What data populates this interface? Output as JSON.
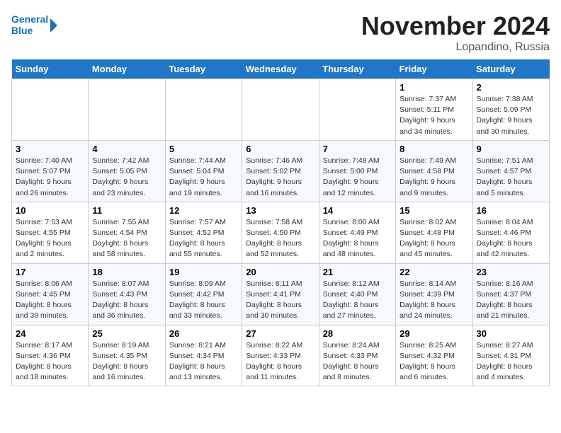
{
  "header": {
    "logo_line1": "General",
    "logo_line2": "Blue",
    "month_title": "November 2024",
    "location": "Lopandino, Russia"
  },
  "weekdays": [
    "Sunday",
    "Monday",
    "Tuesday",
    "Wednesday",
    "Thursday",
    "Friday",
    "Saturday"
  ],
  "weeks": [
    [
      {
        "day": "",
        "info": ""
      },
      {
        "day": "",
        "info": ""
      },
      {
        "day": "",
        "info": ""
      },
      {
        "day": "",
        "info": ""
      },
      {
        "day": "",
        "info": ""
      },
      {
        "day": "1",
        "info": "Sunrise: 7:37 AM\nSunset: 5:11 PM\nDaylight: 9 hours and 34 minutes."
      },
      {
        "day": "2",
        "info": "Sunrise: 7:38 AM\nSunset: 5:09 PM\nDaylight: 9 hours and 30 minutes."
      }
    ],
    [
      {
        "day": "3",
        "info": "Sunrise: 7:40 AM\nSunset: 5:07 PM\nDaylight: 9 hours and 26 minutes."
      },
      {
        "day": "4",
        "info": "Sunrise: 7:42 AM\nSunset: 5:05 PM\nDaylight: 9 hours and 23 minutes."
      },
      {
        "day": "5",
        "info": "Sunrise: 7:44 AM\nSunset: 5:04 PM\nDaylight: 9 hours and 19 minutes."
      },
      {
        "day": "6",
        "info": "Sunrise: 7:46 AM\nSunset: 5:02 PM\nDaylight: 9 hours and 16 minutes."
      },
      {
        "day": "7",
        "info": "Sunrise: 7:48 AM\nSunset: 5:00 PM\nDaylight: 9 hours and 12 minutes."
      },
      {
        "day": "8",
        "info": "Sunrise: 7:49 AM\nSunset: 4:58 PM\nDaylight: 9 hours and 9 minutes."
      },
      {
        "day": "9",
        "info": "Sunrise: 7:51 AM\nSunset: 4:57 PM\nDaylight: 9 hours and 5 minutes."
      }
    ],
    [
      {
        "day": "10",
        "info": "Sunrise: 7:53 AM\nSunset: 4:55 PM\nDaylight: 9 hours and 2 minutes."
      },
      {
        "day": "11",
        "info": "Sunrise: 7:55 AM\nSunset: 4:54 PM\nDaylight: 8 hours and 58 minutes."
      },
      {
        "day": "12",
        "info": "Sunrise: 7:57 AM\nSunset: 4:52 PM\nDaylight: 8 hours and 55 minutes."
      },
      {
        "day": "13",
        "info": "Sunrise: 7:58 AM\nSunset: 4:50 PM\nDaylight: 8 hours and 52 minutes."
      },
      {
        "day": "14",
        "info": "Sunrise: 8:00 AM\nSunset: 4:49 PM\nDaylight: 8 hours and 48 minutes."
      },
      {
        "day": "15",
        "info": "Sunrise: 8:02 AM\nSunset: 4:48 PM\nDaylight: 8 hours and 45 minutes."
      },
      {
        "day": "16",
        "info": "Sunrise: 8:04 AM\nSunset: 4:46 PM\nDaylight: 8 hours and 42 minutes."
      }
    ],
    [
      {
        "day": "17",
        "info": "Sunrise: 8:06 AM\nSunset: 4:45 PM\nDaylight: 8 hours and 39 minutes."
      },
      {
        "day": "18",
        "info": "Sunrise: 8:07 AM\nSunset: 4:43 PM\nDaylight: 8 hours and 36 minutes."
      },
      {
        "day": "19",
        "info": "Sunrise: 8:09 AM\nSunset: 4:42 PM\nDaylight: 8 hours and 33 minutes."
      },
      {
        "day": "20",
        "info": "Sunrise: 8:11 AM\nSunset: 4:41 PM\nDaylight: 8 hours and 30 minutes."
      },
      {
        "day": "21",
        "info": "Sunrise: 8:12 AM\nSunset: 4:40 PM\nDaylight: 8 hours and 27 minutes."
      },
      {
        "day": "22",
        "info": "Sunrise: 8:14 AM\nSunset: 4:39 PM\nDaylight: 8 hours and 24 minutes."
      },
      {
        "day": "23",
        "info": "Sunrise: 8:16 AM\nSunset: 4:37 PM\nDaylight: 8 hours and 21 minutes."
      }
    ],
    [
      {
        "day": "24",
        "info": "Sunrise: 8:17 AM\nSunset: 4:36 PM\nDaylight: 8 hours and 18 minutes."
      },
      {
        "day": "25",
        "info": "Sunrise: 8:19 AM\nSunset: 4:35 PM\nDaylight: 8 hours and 16 minutes."
      },
      {
        "day": "26",
        "info": "Sunrise: 8:21 AM\nSunset: 4:34 PM\nDaylight: 8 hours and 13 minutes."
      },
      {
        "day": "27",
        "info": "Sunrise: 8:22 AM\nSunset: 4:33 PM\nDaylight: 8 hours and 11 minutes."
      },
      {
        "day": "28",
        "info": "Sunrise: 8:24 AM\nSunset: 4:33 PM\nDaylight: 8 hours and 8 minutes."
      },
      {
        "day": "29",
        "info": "Sunrise: 8:25 AM\nSunset: 4:32 PM\nDaylight: 8 hours and 6 minutes."
      },
      {
        "day": "30",
        "info": "Sunrise: 8:27 AM\nSunset: 4:31 PM\nDaylight: 8 hours and 4 minutes."
      }
    ]
  ]
}
